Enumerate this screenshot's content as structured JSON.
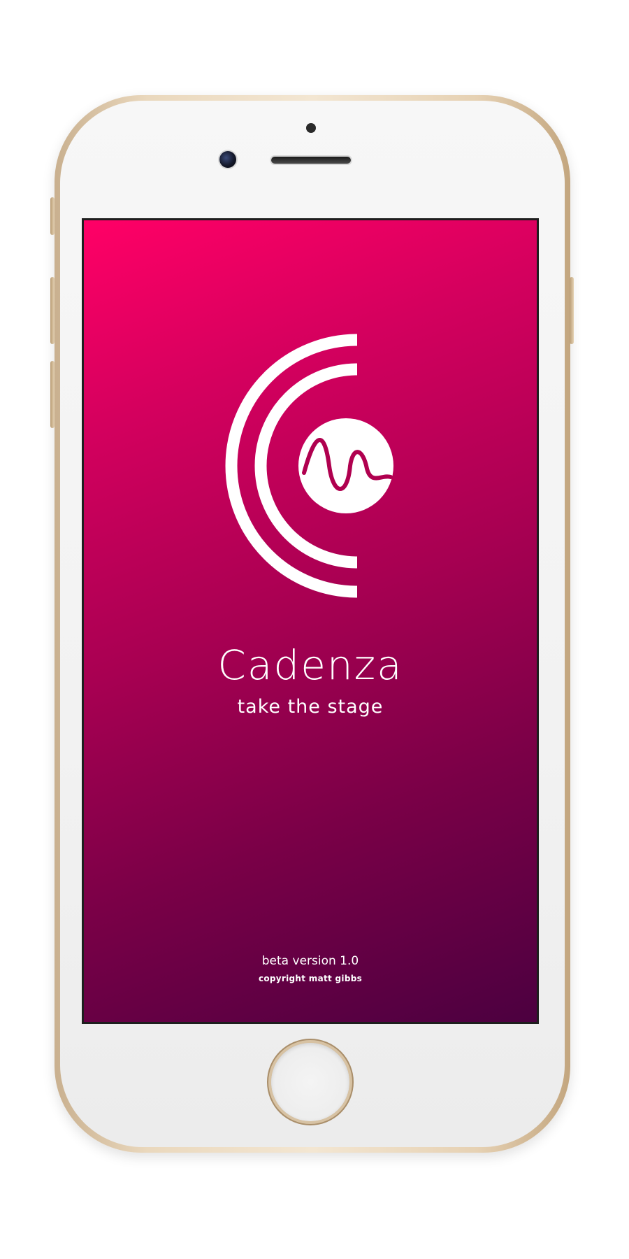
{
  "app": {
    "name": "Cadenza",
    "tagline": "take the stage",
    "version": "beta version 1.0",
    "copyright": "copyright matt gibbs"
  },
  "icons": {
    "logo": "cadenza-logo-icon",
    "camera": "front-camera-icon",
    "home": "home-button-icon"
  },
  "colors": {
    "gradient_start": "#ff0066",
    "gradient_end": "#4c0040",
    "text": "#ffffff",
    "device_frame": "#e6d1b3"
  }
}
